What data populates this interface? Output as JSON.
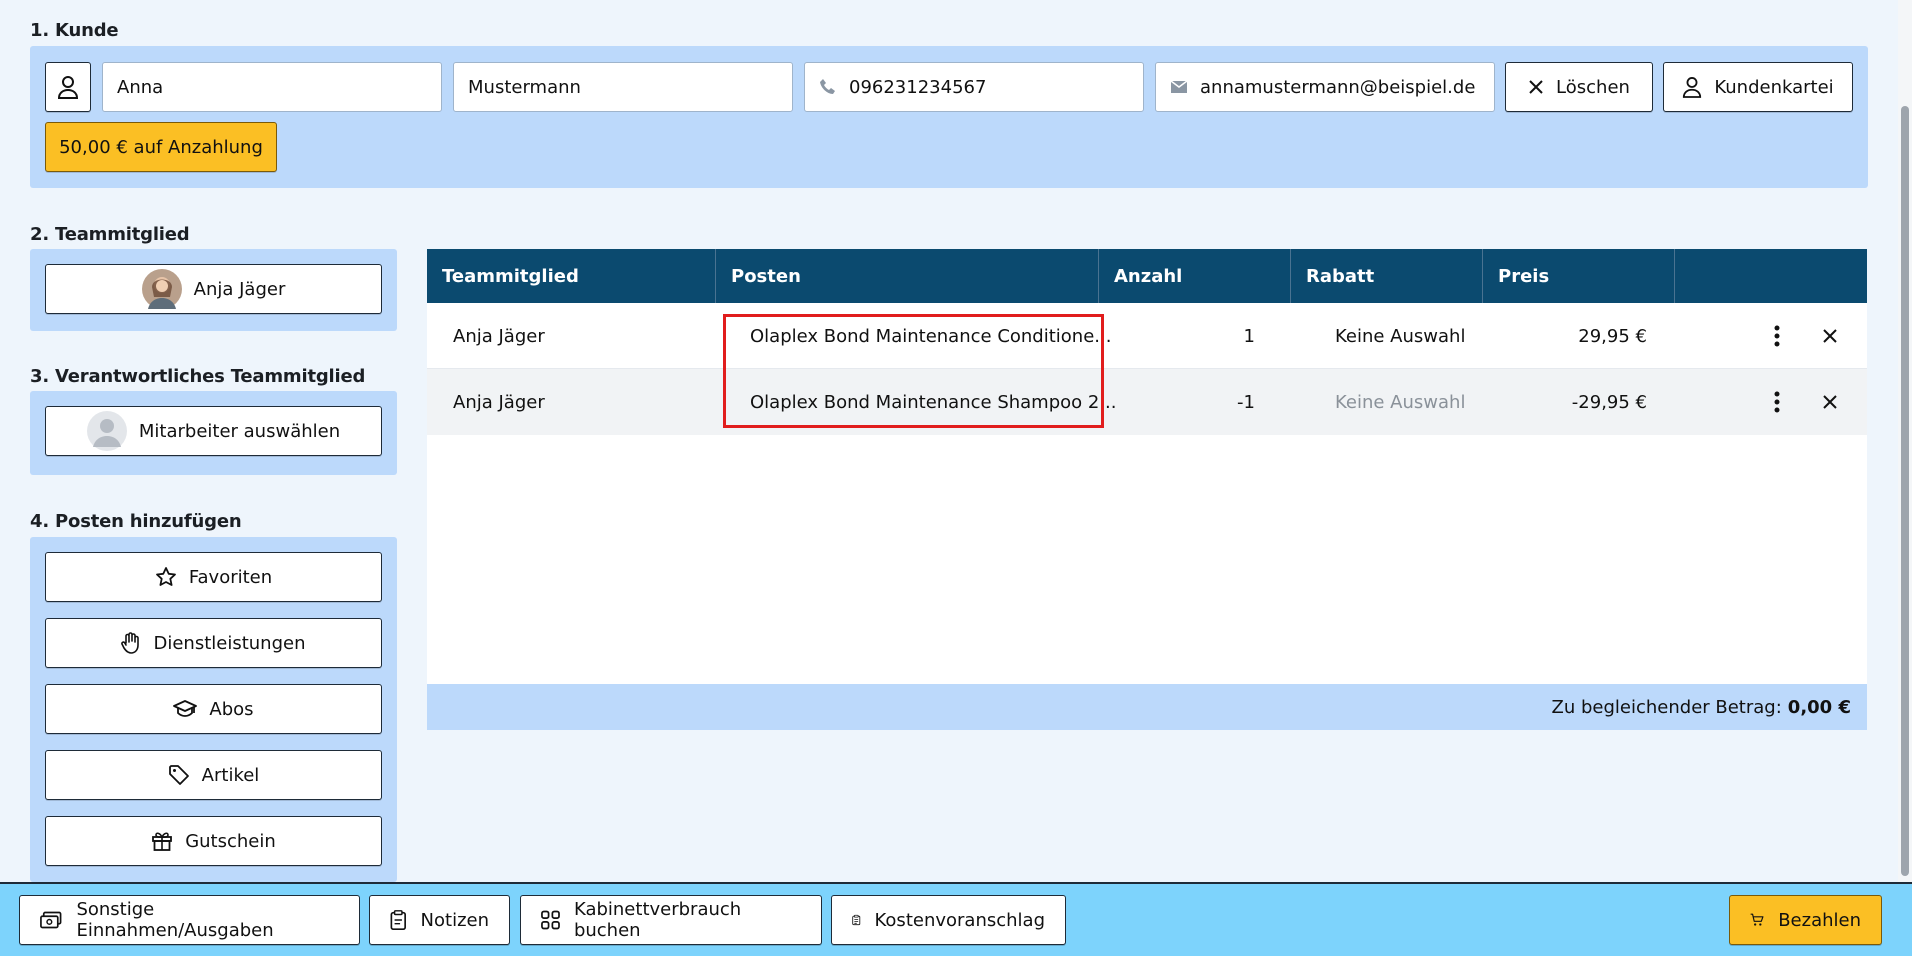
{
  "sections": {
    "customer": "1. Kunde",
    "team_member": "2. Teammitglied",
    "responsible": "3. Verantwortliches Teammitglied",
    "add_items": "4. Posten hinzufügen"
  },
  "customer": {
    "first_name": "Anna",
    "last_name": "Mustermann",
    "phone": "096231234567",
    "email": "annamustermann@beispiel.de",
    "clear_label": "Löschen",
    "file_label": "Kundenkartei",
    "deposit_label": "50,00 € auf Anzahlung"
  },
  "team_member": {
    "name": "Anja Jäger"
  },
  "responsible": {
    "label": "Mitarbeiter auswählen"
  },
  "add_items": {
    "favorites": "Favoriten",
    "services": "Dienstleistungen",
    "subscriptions": "Abos",
    "articles": "Artikel",
    "voucher": "Gutschein"
  },
  "table": {
    "headers": [
      "Teammitglied",
      "Posten",
      "Anzahl",
      "Rabatt",
      "Preis"
    ],
    "rows": [
      {
        "member": "Anja Jäger",
        "item": "Olaplex Bond Maintenance Conditione...",
        "qty": "1",
        "discount": "Keine Auswahl",
        "price": "29,95 €"
      },
      {
        "member": "Anja Jäger",
        "item": "Olaplex Bond Maintenance Shampoo 2...",
        "qty": "-1",
        "discount": "Keine Auswahl",
        "price": "-29,95 €"
      }
    ],
    "total_label": "Zu begleichender Betrag:",
    "total_value": "0,00 €"
  },
  "footer": {
    "other": "Sonstige Einnahmen/Ausgaben",
    "notes": "Notizen",
    "cabinet": "Kabinettverbrauch buchen",
    "estimate": "Kostenvoranschlag",
    "pay": "Bezahlen"
  },
  "colors": {
    "header_bg": "#0b4a6f",
    "panel_bg": "#bcd9fb",
    "footer_bg": "#7dd3fc",
    "accent_yellow": "#fbbf24",
    "highlight_red": "#e11d1d"
  }
}
